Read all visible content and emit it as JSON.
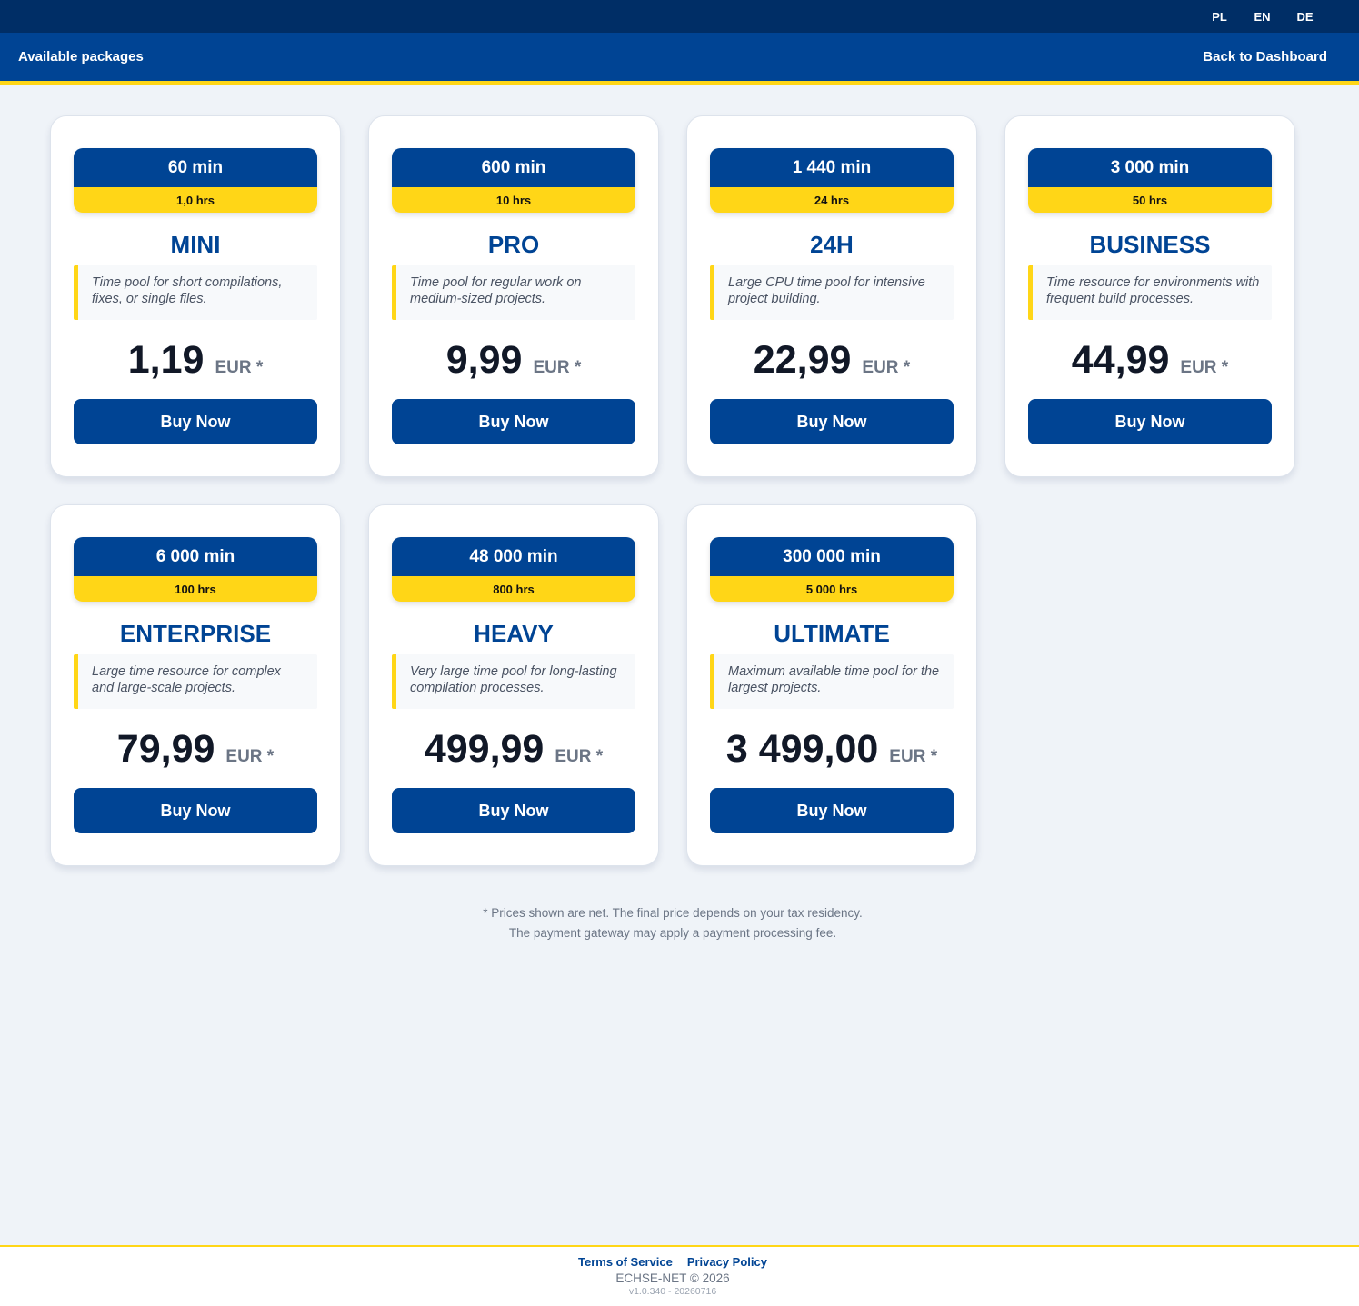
{
  "languages": [
    "PL",
    "EN",
    "DE"
  ],
  "header": {
    "title": "Available packages",
    "back_label": "Back to Dashboard"
  },
  "colors": {
    "primary": "#004494",
    "topbar": "#002e66",
    "accent": "#ffd617",
    "background": "#eff3f8"
  },
  "packages": [
    {
      "minutes": "60 min",
      "hours": "1,0 hrs",
      "name": "MINI",
      "description": "Time pool for short compilations, fixes, or single files.",
      "price": "1,19",
      "currency": "EUR *",
      "button": "Buy Now"
    },
    {
      "minutes": "600 min",
      "hours": "10 hrs",
      "name": "PRO",
      "description": "Time pool for regular work on medium-sized projects.",
      "price": "9,99",
      "currency": "EUR *",
      "button": "Buy Now"
    },
    {
      "minutes": "1 440 min",
      "hours": "24 hrs",
      "name": "24H",
      "description": "Large CPU time pool for intensive project building.",
      "price": "22,99",
      "currency": "EUR *",
      "button": "Buy Now"
    },
    {
      "minutes": "3 000 min",
      "hours": "50 hrs",
      "name": "BUSINESS",
      "description": "Time resource for environments with frequent build processes.",
      "price": "44,99",
      "currency": "EUR *",
      "button": "Buy Now"
    },
    {
      "minutes": "6 000 min",
      "hours": "100 hrs",
      "name": "ENTERPRISE",
      "description": "Large time resource for complex and large-scale projects.",
      "price": "79,99",
      "currency": "EUR *",
      "button": "Buy Now"
    },
    {
      "minutes": "48 000 min",
      "hours": "800 hrs",
      "name": "HEAVY",
      "description": "Very large time pool for long-lasting compilation processes.",
      "price": "499,99",
      "currency": "EUR *",
      "button": "Buy Now"
    },
    {
      "minutes": "300 000 min",
      "hours": "5 000 hrs",
      "name": "ULTIMATE",
      "description": "Maximum available time pool for the largest projects.",
      "price": "3 499,00",
      "currency": "EUR *",
      "button": "Buy Now"
    }
  ],
  "note": {
    "line1": "* Prices shown are net. The final price depends on your tax residency.",
    "line2": "The payment gateway may apply a payment processing fee."
  },
  "footer": {
    "terms": "Terms of Service",
    "privacy": "Privacy Policy",
    "copyright": "ECHSE-NET © 2026",
    "version": "v1.0.340 - 20260716"
  }
}
